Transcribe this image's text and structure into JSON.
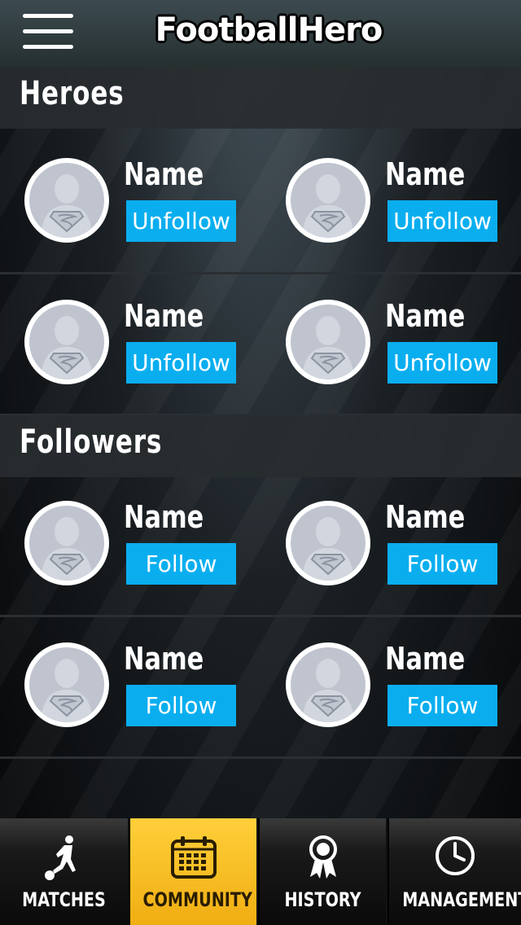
{
  "header": {
    "logo_text": "FootballHero"
  },
  "heroes": {
    "title": "Heroes",
    "rows": [
      [
        {
          "name": "Name",
          "action": "Unfollow"
        },
        {
          "name": "Name",
          "action": "Unfollow"
        }
      ],
      [
        {
          "name": "Name",
          "action": "Unfollow"
        },
        {
          "name": "Name",
          "action": "Unfollow"
        }
      ]
    ]
  },
  "followers": {
    "title": "Followers",
    "rows": [
      [
        {
          "name": "Name",
          "action": "Follow"
        },
        {
          "name": "Name",
          "action": "Follow"
        }
      ],
      [
        {
          "name": "Name",
          "action": "Follow"
        },
        {
          "name": "Name",
          "action": "Follow"
        }
      ]
    ]
  },
  "tabs": [
    {
      "label": "MATCHES",
      "icon": "soccer-player-icon",
      "active": false
    },
    {
      "label": "COMMUNITY",
      "icon": "calendar-icon",
      "active": true
    },
    {
      "label": "HISTORY",
      "icon": "award-ribbon-icon",
      "active": false
    },
    {
      "label": "MANAGEMENT",
      "icon": "clock-icon",
      "active": false
    }
  ],
  "colors": {
    "button": "#0aaeef",
    "active_tab": "#f5b520",
    "background": "#000000"
  }
}
